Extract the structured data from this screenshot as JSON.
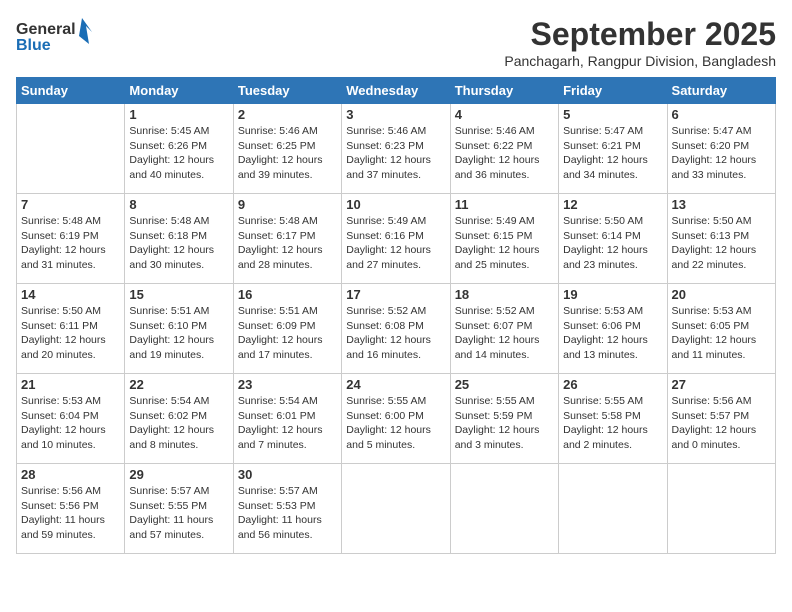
{
  "logo": {
    "line1": "General",
    "line2": "Blue"
  },
  "title": {
    "month_year": "September 2025",
    "location": "Panchagarh, Rangpur Division, Bangladesh"
  },
  "weekdays": [
    "Sunday",
    "Monday",
    "Tuesday",
    "Wednesday",
    "Thursday",
    "Friday",
    "Saturday"
  ],
  "weeks": [
    [
      {
        "day": "",
        "info": ""
      },
      {
        "day": "1",
        "info": "Sunrise: 5:45 AM\nSunset: 6:26 PM\nDaylight: 12 hours\nand 40 minutes."
      },
      {
        "day": "2",
        "info": "Sunrise: 5:46 AM\nSunset: 6:25 PM\nDaylight: 12 hours\nand 39 minutes."
      },
      {
        "day": "3",
        "info": "Sunrise: 5:46 AM\nSunset: 6:23 PM\nDaylight: 12 hours\nand 37 minutes."
      },
      {
        "day": "4",
        "info": "Sunrise: 5:46 AM\nSunset: 6:22 PM\nDaylight: 12 hours\nand 36 minutes."
      },
      {
        "day": "5",
        "info": "Sunrise: 5:47 AM\nSunset: 6:21 PM\nDaylight: 12 hours\nand 34 minutes."
      },
      {
        "day": "6",
        "info": "Sunrise: 5:47 AM\nSunset: 6:20 PM\nDaylight: 12 hours\nand 33 minutes."
      }
    ],
    [
      {
        "day": "7",
        "info": "Sunrise: 5:48 AM\nSunset: 6:19 PM\nDaylight: 12 hours\nand 31 minutes."
      },
      {
        "day": "8",
        "info": "Sunrise: 5:48 AM\nSunset: 6:18 PM\nDaylight: 12 hours\nand 30 minutes."
      },
      {
        "day": "9",
        "info": "Sunrise: 5:48 AM\nSunset: 6:17 PM\nDaylight: 12 hours\nand 28 minutes."
      },
      {
        "day": "10",
        "info": "Sunrise: 5:49 AM\nSunset: 6:16 PM\nDaylight: 12 hours\nand 27 minutes."
      },
      {
        "day": "11",
        "info": "Sunrise: 5:49 AM\nSunset: 6:15 PM\nDaylight: 12 hours\nand 25 minutes."
      },
      {
        "day": "12",
        "info": "Sunrise: 5:50 AM\nSunset: 6:14 PM\nDaylight: 12 hours\nand 23 minutes."
      },
      {
        "day": "13",
        "info": "Sunrise: 5:50 AM\nSunset: 6:13 PM\nDaylight: 12 hours\nand 22 minutes."
      }
    ],
    [
      {
        "day": "14",
        "info": "Sunrise: 5:50 AM\nSunset: 6:11 PM\nDaylight: 12 hours\nand 20 minutes."
      },
      {
        "day": "15",
        "info": "Sunrise: 5:51 AM\nSunset: 6:10 PM\nDaylight: 12 hours\nand 19 minutes."
      },
      {
        "day": "16",
        "info": "Sunrise: 5:51 AM\nSunset: 6:09 PM\nDaylight: 12 hours\nand 17 minutes."
      },
      {
        "day": "17",
        "info": "Sunrise: 5:52 AM\nSunset: 6:08 PM\nDaylight: 12 hours\nand 16 minutes."
      },
      {
        "day": "18",
        "info": "Sunrise: 5:52 AM\nSunset: 6:07 PM\nDaylight: 12 hours\nand 14 minutes."
      },
      {
        "day": "19",
        "info": "Sunrise: 5:53 AM\nSunset: 6:06 PM\nDaylight: 12 hours\nand 13 minutes."
      },
      {
        "day": "20",
        "info": "Sunrise: 5:53 AM\nSunset: 6:05 PM\nDaylight: 12 hours\nand 11 minutes."
      }
    ],
    [
      {
        "day": "21",
        "info": "Sunrise: 5:53 AM\nSunset: 6:04 PM\nDaylight: 12 hours\nand 10 minutes."
      },
      {
        "day": "22",
        "info": "Sunrise: 5:54 AM\nSunset: 6:02 PM\nDaylight: 12 hours\nand 8 minutes."
      },
      {
        "day": "23",
        "info": "Sunrise: 5:54 AM\nSunset: 6:01 PM\nDaylight: 12 hours\nand 7 minutes."
      },
      {
        "day": "24",
        "info": "Sunrise: 5:55 AM\nSunset: 6:00 PM\nDaylight: 12 hours\nand 5 minutes."
      },
      {
        "day": "25",
        "info": "Sunrise: 5:55 AM\nSunset: 5:59 PM\nDaylight: 12 hours\nand 3 minutes."
      },
      {
        "day": "26",
        "info": "Sunrise: 5:55 AM\nSunset: 5:58 PM\nDaylight: 12 hours\nand 2 minutes."
      },
      {
        "day": "27",
        "info": "Sunrise: 5:56 AM\nSunset: 5:57 PM\nDaylight: 12 hours\nand 0 minutes."
      }
    ],
    [
      {
        "day": "28",
        "info": "Sunrise: 5:56 AM\nSunset: 5:56 PM\nDaylight: 11 hours\nand 59 minutes."
      },
      {
        "day": "29",
        "info": "Sunrise: 5:57 AM\nSunset: 5:55 PM\nDaylight: 11 hours\nand 57 minutes."
      },
      {
        "day": "30",
        "info": "Sunrise: 5:57 AM\nSunset: 5:53 PM\nDaylight: 11 hours\nand 56 minutes."
      },
      {
        "day": "",
        "info": ""
      },
      {
        "day": "",
        "info": ""
      },
      {
        "day": "",
        "info": ""
      },
      {
        "day": "",
        "info": ""
      }
    ]
  ]
}
